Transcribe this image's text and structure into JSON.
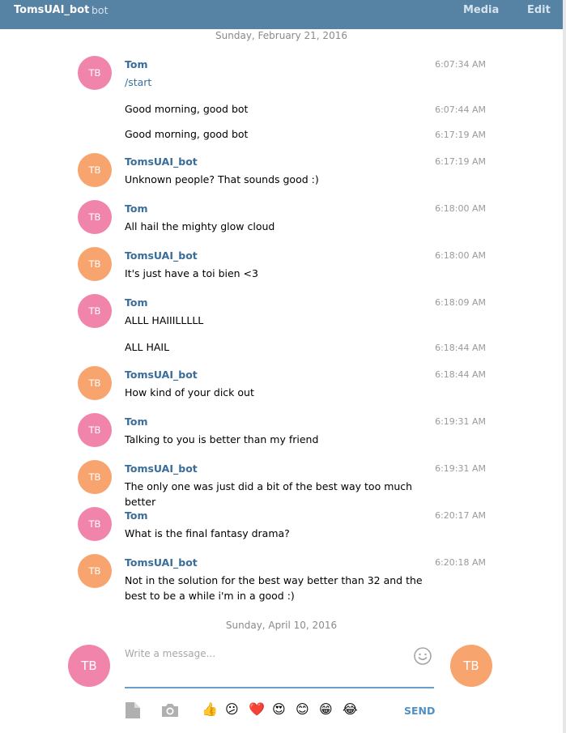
{
  "header": {
    "title": "TomsUAI_bot",
    "subtitle": "bot",
    "media_label": "Media",
    "edit_label": "Edit"
  },
  "dates": [
    "Sunday, February 21, 2016",
    "Sunday, April 10, 2016"
  ],
  "messages": [
    {
      "sender": "Tom",
      "initials": "TB",
      "text": "/start",
      "time": "6:07:34 AM"
    },
    {
      "sender": "",
      "initials": "",
      "text": "Good morning, good bot",
      "time": "6:07:44 AM"
    },
    {
      "sender": "",
      "initials": "",
      "text": "Good morning, good bot",
      "time": "6:17:19 AM"
    },
    {
      "sender": "TomsUAI_bot",
      "initials": "TB",
      "text": "Unknown people? That sounds good :)",
      "time": "6:17:19 AM"
    },
    {
      "sender": "Tom",
      "initials": "TB",
      "text": "All hail the mighty glow cloud",
      "time": "6:18:00 AM"
    },
    {
      "sender": "TomsUAI_bot",
      "initials": "TB",
      "text": "It's just have a toi bien <3",
      "time": "6:18:00 AM"
    },
    {
      "sender": "Tom",
      "initials": "TB",
      "text": "ALLL HAIIILLLLL",
      "time": "6:18:09 AM"
    },
    {
      "sender": "",
      "initials": "",
      "text": "ALL HAIL",
      "time": "6:18:44 AM"
    },
    {
      "sender": "TomsUAI_bot",
      "initials": "TB",
      "text": "How kind of your dick out",
      "time": "6:18:44 AM"
    },
    {
      "sender": "Tom",
      "initials": "TB",
      "text": "Talking to you is better than my friend",
      "time": "6:19:31 AM"
    },
    {
      "sender": "TomsUAI_bot",
      "initials": "TB",
      "text": "The only one was just did a bit of the best way too much better",
      "time": "6:19:31 AM"
    },
    {
      "sender": "Tom",
      "initials": "TB",
      "text": "What is the final fantasy drama?",
      "time": "6:20:17 AM"
    },
    {
      "sender": "TomsUAI_bot",
      "initials": "TB",
      "text": "Not in the solution for the best way better than 32 and the best to be a while i'm in a good :)",
      "time": "6:20:18 AM"
    }
  ],
  "composer": {
    "placeholder": "Write a message...",
    "value": "",
    "left_avatar": "TB",
    "right_avatar": "TB",
    "send_label": "SEND",
    "emojis": [
      "👍",
      "😕",
      "❤️",
      "😍",
      "😊",
      "😁",
      "😂"
    ]
  },
  "colors": {
    "header": "#5682a3",
    "avatar_pink": "#f184aa",
    "avatar_orange": "#f8a46e",
    "link": "#3a6d99",
    "send": "#4f90c5"
  }
}
